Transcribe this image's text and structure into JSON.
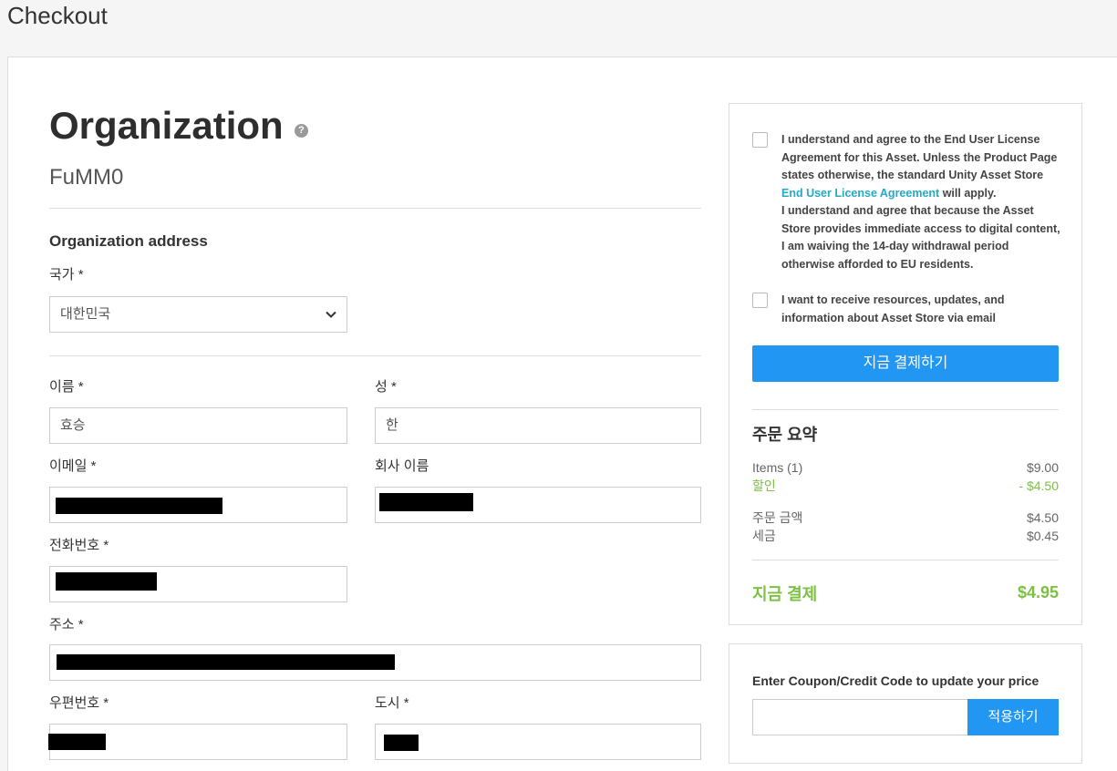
{
  "page": {
    "title": "Checkout"
  },
  "organization": {
    "heading": "Organization",
    "help_icon": "question-circle-icon",
    "name": "FuMM0",
    "address_section_title": "Organization address"
  },
  "form": {
    "country": {
      "label": "국가 *",
      "value": "대한민국"
    },
    "first_name": {
      "label": "이름 *",
      "value": "효승"
    },
    "last_name": {
      "label": "성 *",
      "value": "한"
    },
    "email": {
      "label": "이메일 *"
    },
    "company": {
      "label": "회사 이름"
    },
    "phone": {
      "label": "전화번호 *"
    },
    "address": {
      "label": "주소 *"
    },
    "postal_code": {
      "label": "우편번호 *"
    },
    "city": {
      "label": "도시 *"
    }
  },
  "agreement": {
    "eula_text_1": "I understand and agree to the End User License Agreement for this Asset. Unless the Product Page states otherwise, the standard Unity Asset Store",
    "eula_link": "End User License Agreement",
    "eula_text_2": "will apply.",
    "withdrawal_text": "I understand and agree that because the Asset Store provides immediate access to digital content, I am waiving the 14-day withdrawal period otherwise afforded to EU residents.",
    "newsletter_text": "I want to receive resources, updates, and information about Asset Store via email"
  },
  "pay_button_label": "지금 결제하기",
  "summary": {
    "title": "주문 요약",
    "items_label": "Items (1)",
    "items_value": "$9.00",
    "discount_label": "할인",
    "discount_value": "- $4.50",
    "subtotal_label": "주문 금액",
    "subtotal_value": "$4.50",
    "tax_label": "세금",
    "tax_value": "$0.45",
    "total_label": "지금 결제",
    "total_value": "$4.95"
  },
  "coupon": {
    "label": "Enter Coupon/Credit Code to update your price",
    "placeholder": "",
    "apply_label": "적용하기"
  },
  "colors": {
    "accent_blue": "#2196f3",
    "link_teal": "#24a9c9",
    "success_green": "#7cc142"
  }
}
